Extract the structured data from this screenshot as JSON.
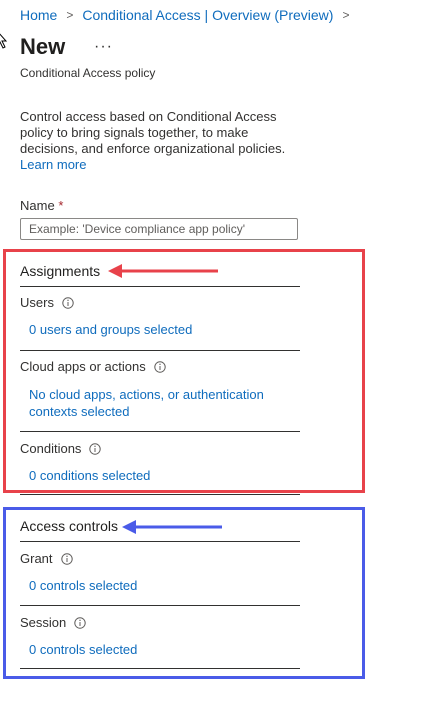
{
  "breadcrumb": {
    "items": [
      "Home",
      "Conditional Access | Overview (Preview)"
    ],
    "separator": ">"
  },
  "header": {
    "title": "New",
    "more_label": "···",
    "subtitle": "Conditional Access policy"
  },
  "description": {
    "text": "Control access based on Conditional Access policy to bring signals together, to make decisions, and enforce organizational policies.",
    "learn_more": "Learn more"
  },
  "name_field": {
    "label": "Name",
    "required_mark": "*",
    "value": "",
    "placeholder": "Example: 'Device compliance app policy'"
  },
  "assignments": {
    "title": "Assignments",
    "users": {
      "label": "Users",
      "value": "0 users and groups selected"
    },
    "cloud_apps": {
      "label": "Cloud apps or actions",
      "value": "No cloud apps, actions, or authentication contexts selected"
    },
    "conditions": {
      "label": "Conditions",
      "value": "0 conditions selected"
    }
  },
  "access_controls": {
    "title": "Access controls",
    "grant": {
      "label": "Grant",
      "value": "0 controls selected"
    },
    "session": {
      "label": "Session",
      "value": "0 controls selected"
    }
  },
  "colors": {
    "link": "#0f6cbd",
    "red_highlight": "#e8424a",
    "blue_highlight": "#4a5be8",
    "required": "#a4262c"
  }
}
